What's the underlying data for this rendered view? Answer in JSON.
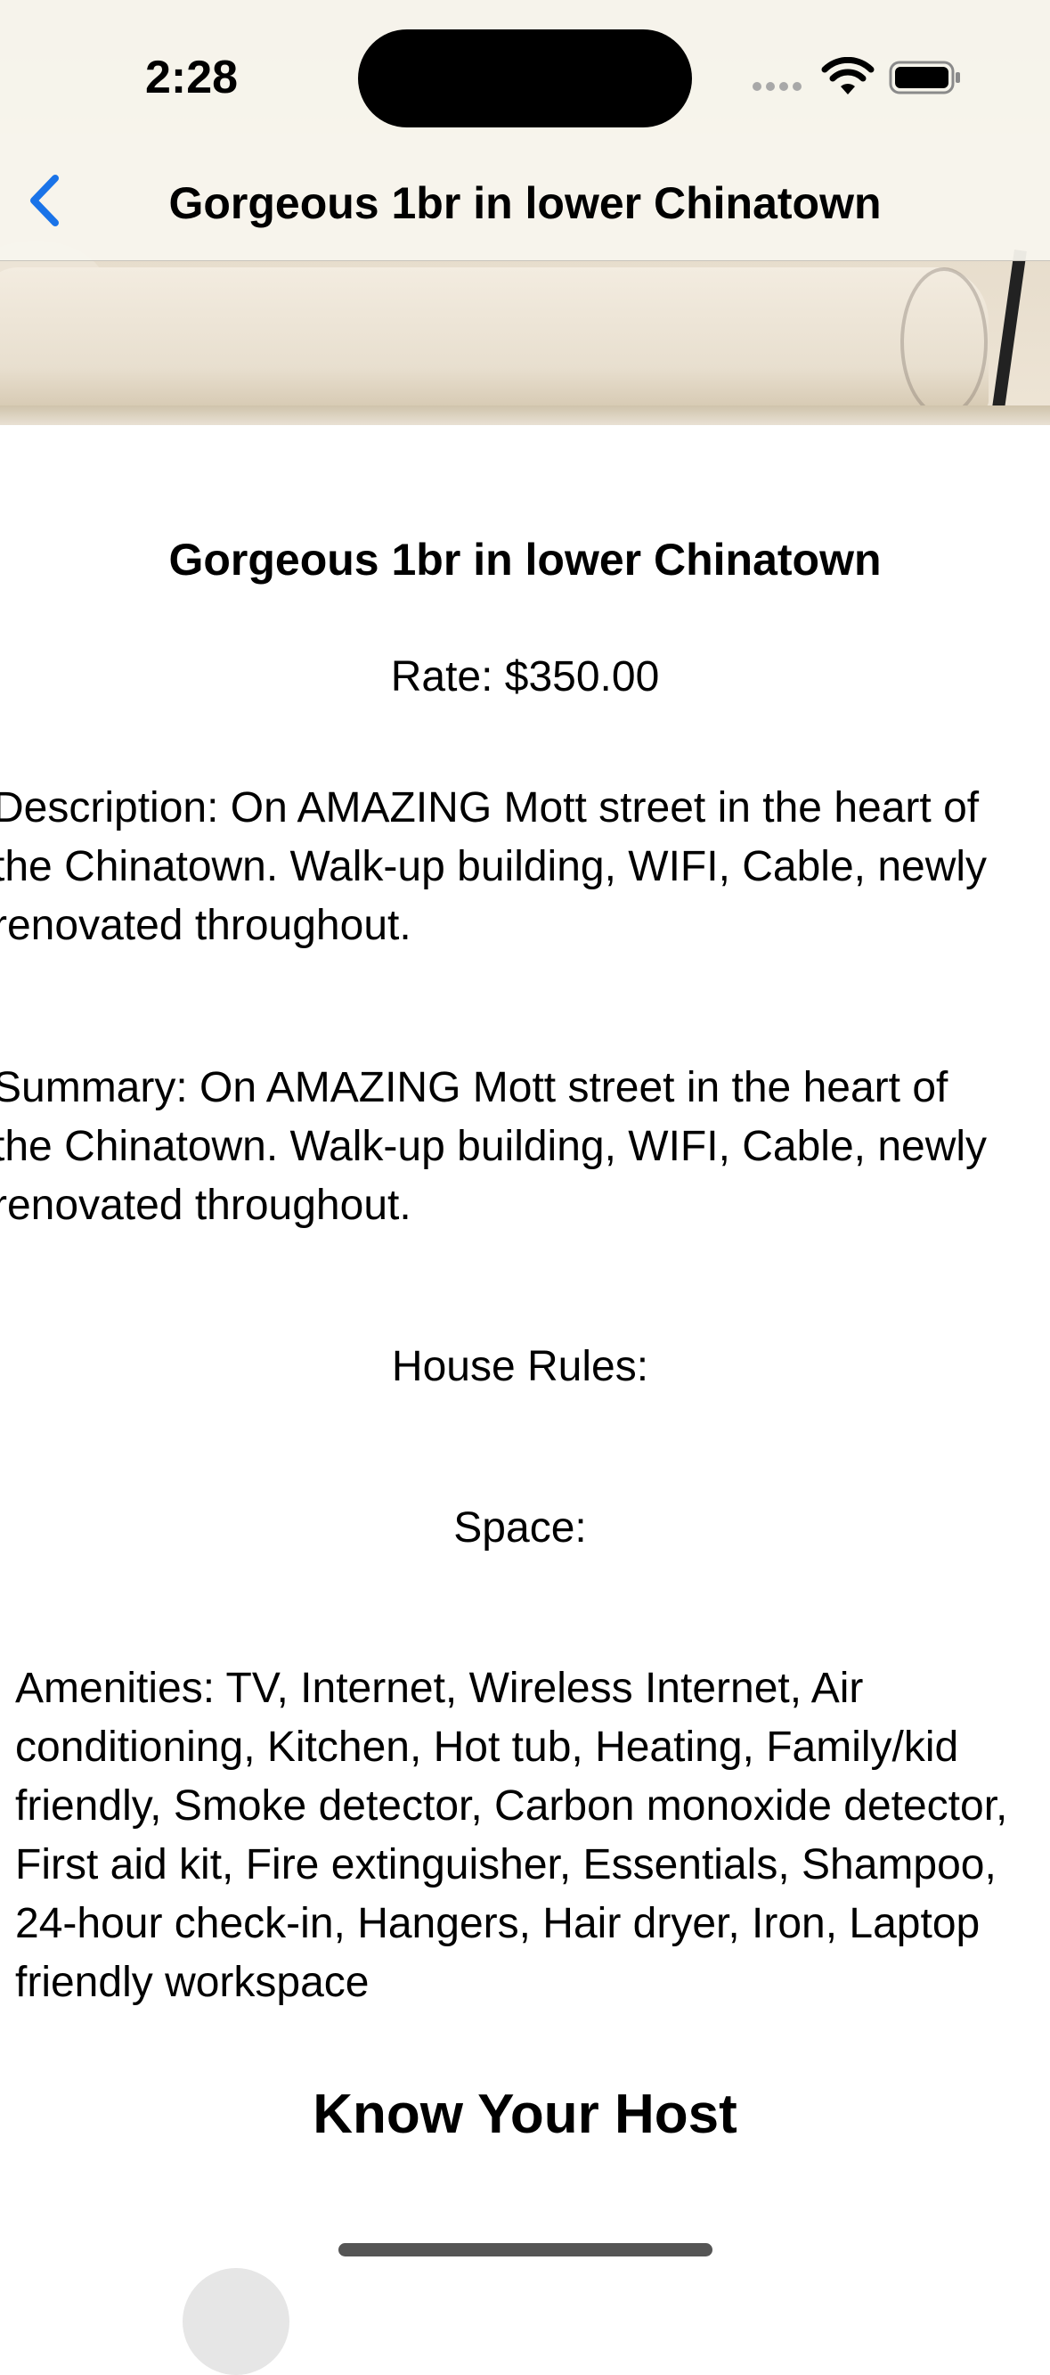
{
  "status_bar": {
    "time": "2:28"
  },
  "nav": {
    "title": "Gorgeous 1br in lower Chinatown",
    "back_icon": "chevron-left-icon",
    "accent_color": "#1a73e8"
  },
  "listing": {
    "name": "Gorgeous 1br in lower Chinatown",
    "rate": "Rate: $350.00",
    "description": "Description: On AMAZING Mott street in the heart of\nthe Chinatown. Walk-up building, WIFI, Cable, newly\nrenovated throughout.",
    "summary": "Summary: On AMAZING Mott street in the heart of\nthe Chinatown. Walk-up building, WIFI, Cable, newly\nrenovated throughout.",
    "house_rules": "House Rules:",
    "space": "Space:",
    "amenities": "Amenities: TV, Internet, Wireless Internet, Air conditioning, Kitchen, Hot tub, Heating, Family/kid friendly, Smoke detector, Carbon monoxide detector, First aid kit, Fire extinguisher, Essentials, Shampoo, 24-hour check-in, Hangers, Hair dryer, Iron, Laptop friendly workspace"
  },
  "host_section": {
    "heading": "Know Your Host"
  }
}
